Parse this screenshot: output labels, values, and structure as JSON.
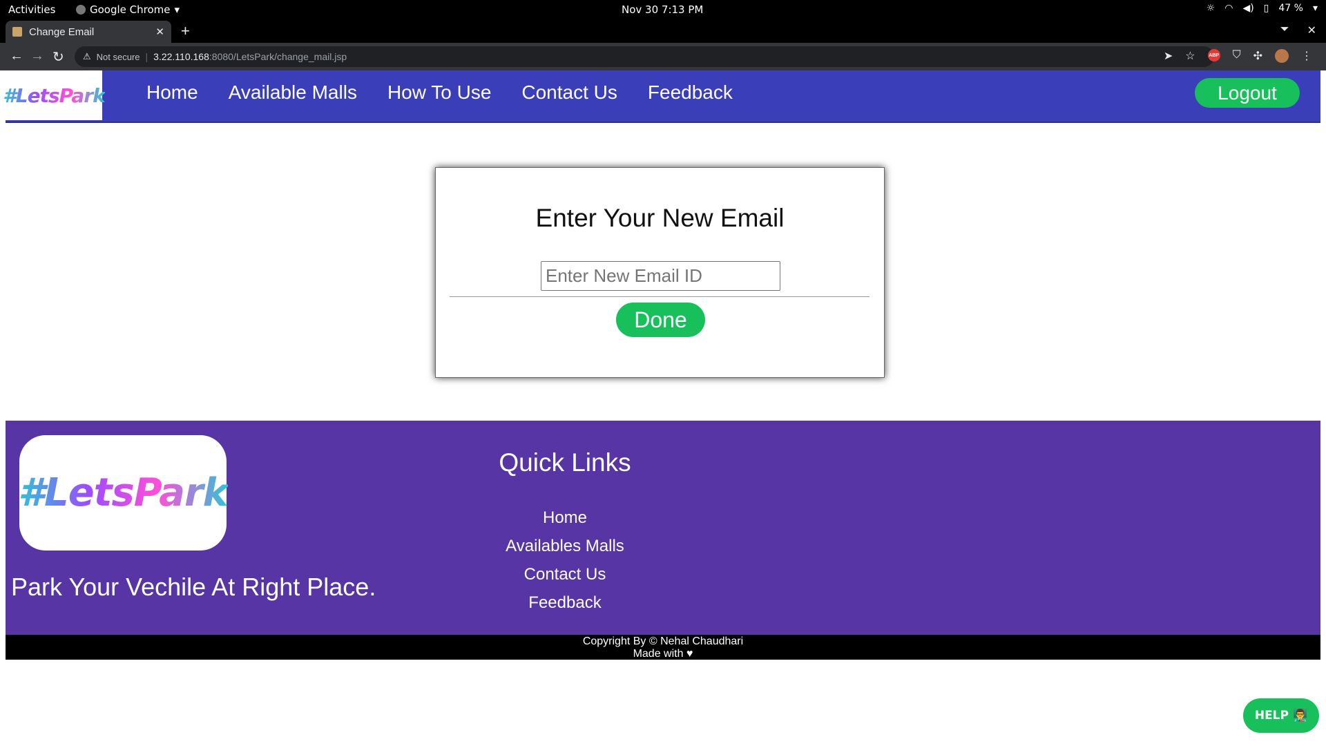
{
  "system": {
    "activities": "Activities",
    "app_name": "Google Chrome",
    "clock": "Nov 30  7:13 PM",
    "battery": "47 %"
  },
  "browser": {
    "tab_title": "Change Email",
    "security_label": "Not secure",
    "url_host": "3.22.110.168",
    "url_path": ":8080/LetsPark/change_mail.jsp"
  },
  "navbar": {
    "logo": "#LetsPark",
    "links": [
      "Home",
      "Available Malls",
      "How To Use",
      "Contact Us",
      "Feedback"
    ],
    "logout_label": "Logout"
  },
  "form": {
    "heading": "Enter Your New Email",
    "email_placeholder": "Enter New Email ID",
    "email_value": "",
    "done_label": "Done"
  },
  "footer": {
    "logo": "#LetsPark",
    "tagline": "Park Your Vechile At Right Place.",
    "quick_links_title": "Quick Links",
    "quick_links": [
      "Home",
      "Availables Malls",
      "Contact Us",
      "Feedback"
    ],
    "copyright": "Copyright By © Nehal Chaudhari",
    "made_with": "Made with ♥"
  },
  "help": {
    "label": "HELP",
    "emoji": "👨‍🏫"
  },
  "colors": {
    "navbar_bg": "#3a3eb9",
    "footer_bg": "#5735a4",
    "button_green": "#17c05b"
  }
}
